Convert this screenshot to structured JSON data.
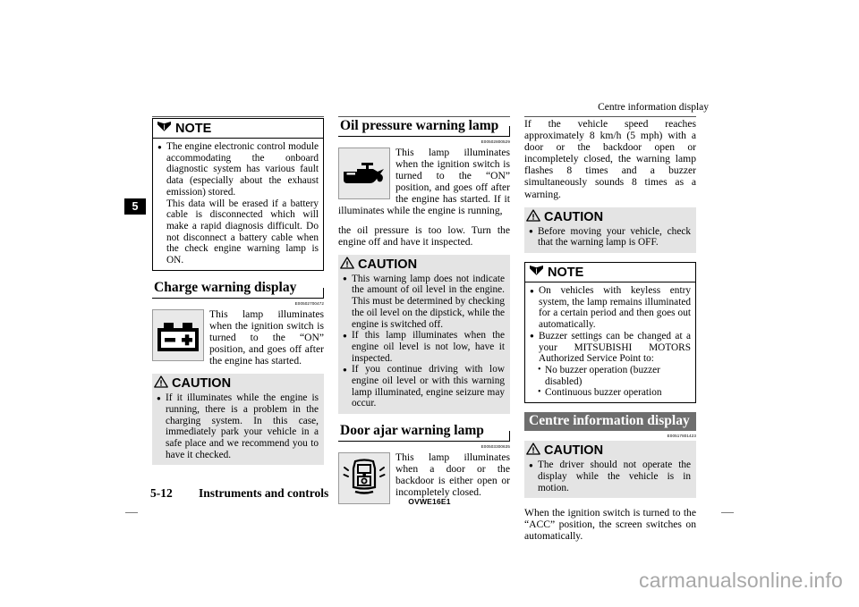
{
  "running_head": "Centre information display",
  "chapter_tab": "5",
  "column1": {
    "note": {
      "icon": "open-book-icon",
      "title": "NOTE",
      "items": [
        "The engine electronic control module accommodating the onboard diagnostic system has various fault data (especially about the exhaust emission) stored.",
        "This data will be erased if a battery cable is disconnected which will make a rapid diagnosis difficult. Do not disconnect a battery cable when the check engine warning lamp is ON."
      ]
    },
    "section": {
      "heading": "Charge warning display",
      "refcode": "E00502700472",
      "figure_icon": "battery-warning-lamp-icon",
      "body": "This lamp illuminates when the ignition switch is turned to the “ON” position, and goes off after the engine has started."
    },
    "caution": {
      "icon": "warning-triangle-icon",
      "title": "CAUTION",
      "items": [
        "If it illuminates while the engine is running, there is a problem in the charging system. In this case, immediately park your vehicle in a safe place and we recommend you to have it checked."
      ]
    }
  },
  "column2": {
    "section1": {
      "heading": "Oil pressure warning lamp",
      "refcode": "E00502800529",
      "figure_icon": "oil-can-warning-lamp-icon",
      "body_wrapped": "This lamp illuminates when the ignition switch is turned to the “ON” position, and goes off after the engine has started. If it illuminates while the engine is running,",
      "body_rest": "the oil pressure is too low. Turn the engine off and have it inspected."
    },
    "caution": {
      "icon": "warning-triangle-icon",
      "title": "CAUTION",
      "items": [
        "This warning lamp does not indicate the amount of oil level in the engine. This must be determined by checking the oil level on the dipstick, while the engine is switched off.",
        "If this lamp illuminates when the engine oil level is not low, have it inspected.",
        "If you continue driving with low engine oil level or with this warning lamp illuminated, engine seizure may occur."
      ]
    },
    "section2": {
      "heading": "Door ajar warning lamp",
      "refcode": "E00503300635",
      "figure_icon": "door-ajar-warning-lamp-icon",
      "body": "This lamp illuminates when a door or the backdoor is either open or incompletely closed."
    }
  },
  "column3": {
    "intro": "If the vehicle speed reaches approximately 8 km/h (5 mph) with a door or the backdoor open or incompletely closed, the warning lamp flashes 8 times and a buzzer simultaneously sounds 8 times as a warning.",
    "caution1": {
      "icon": "warning-triangle-icon",
      "title": "CAUTION",
      "items": [
        "Before moving your vehicle, check that the warning lamp is OFF."
      ]
    },
    "note": {
      "icon": "open-book-icon",
      "title": "NOTE",
      "items": [
        "On vehicles with keyless entry system, the lamp remains illuminated for a certain period and then goes out automatically.",
        "Buzzer settings can be changed at a your MITSUBISHI MOTORS Authorized Service Point to:"
      ],
      "subitems": [
        "No buzzer operation (buzzer disabled)",
        "Continuous buzzer operation"
      ]
    },
    "section": {
      "heading": "Centre information display",
      "refcode": "E00517801423"
    },
    "caution2": {
      "icon": "warning-triangle-icon",
      "title": "CAUTION",
      "items": [
        "The driver should not operate the display while the vehicle is in motion."
      ]
    },
    "closing": "When the ignition switch is turned to the “ACC” position, the screen switches on automatically."
  },
  "footer": {
    "page_number": "5-12",
    "section_name": "Instruments and controls",
    "doc_code": "OVWE16E1"
  },
  "watermark": "carmanualsonline.info",
  "colors": {
    "caution_panel": "#e4e4e4",
    "figure_panel": "#e9e9e9",
    "filled_heading": "#6e6e6e",
    "watermark": "#a8a8a8"
  }
}
